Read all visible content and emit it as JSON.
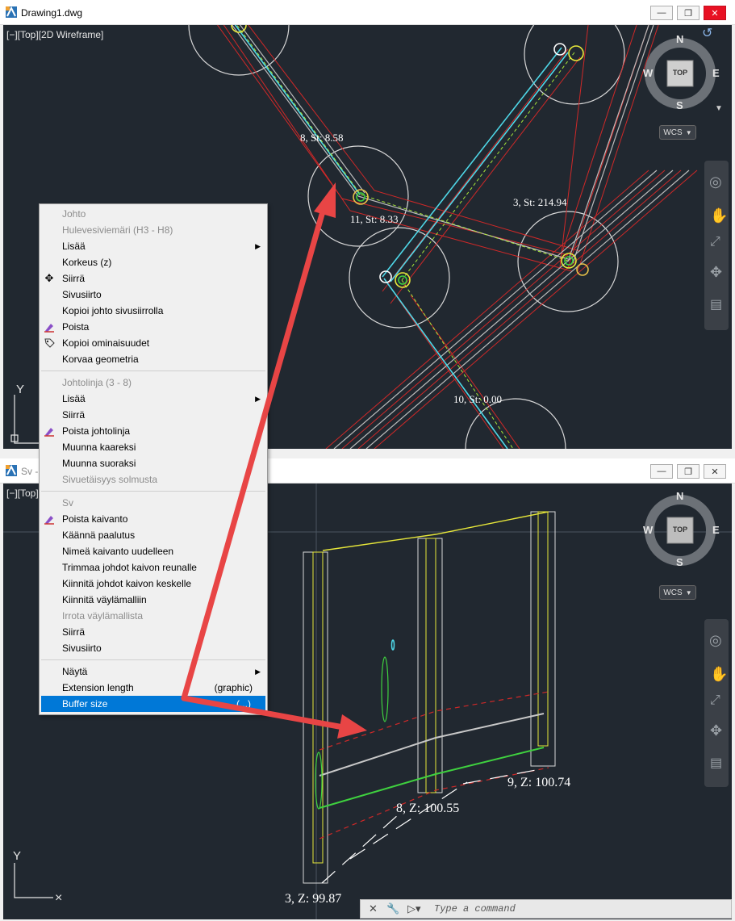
{
  "top_window": {
    "title": "Drawing1.dwg",
    "viewport_label": "[−][Top][2D Wireframe]",
    "compass": {
      "n": "N",
      "s": "S",
      "e": "E",
      "w": "W",
      "center": "TOP"
    },
    "wcs": "WCS",
    "labels": [
      "8, St: 8.58",
      "11, St: 8.33",
      "3, St: 214.94",
      "10, St: 0.00"
    ],
    "ucs_y": "Y"
  },
  "bottom_window": {
    "title": "Sv - Y...",
    "viewport_label": "[−][Top]",
    "compass": {
      "n": "N",
      "s": "S",
      "e": "E",
      "w": "W",
      "center": "TOP"
    },
    "wcs": "WCS",
    "labels": [
      "9, Z: 100.74",
      "8, Z: 100.55",
      "3, Z: 99.87"
    ],
    "ucs_y": "Y"
  },
  "context_menu": {
    "sections": [
      {
        "items": [
          {
            "label": "Johto",
            "disabled": true
          },
          {
            "label": "Hulevesiviemäri (H3 - H8)",
            "disabled": true
          },
          {
            "label": "Lisää",
            "submenu": true
          },
          {
            "label": "Korkeus (z)"
          },
          {
            "label": "Siirrä",
            "icon": "move-icon"
          },
          {
            "label": "Sivusiirto"
          },
          {
            "label": "Kopioi johto sivusiirrolla"
          },
          {
            "label": "Poista",
            "icon": "erase-icon"
          },
          {
            "label": "Kopioi ominaisuudet",
            "icon": "match-properties-icon"
          },
          {
            "label": "Korvaa geometria"
          }
        ]
      },
      {
        "items": [
          {
            "label": "Johtolinja (3 - 8)",
            "disabled": true
          },
          {
            "label": "Lisää",
            "submenu": true
          },
          {
            "label": "Siirrä"
          },
          {
            "label": "Poista johtolinja",
            "icon": "erase-icon"
          },
          {
            "label": "Muunna kaareksi"
          },
          {
            "label": "Muunna suoraksi"
          },
          {
            "label": "Sivuetäisyys solmusta",
            "disabled": true
          }
        ]
      },
      {
        "items": [
          {
            "label": "Sv",
            "disabled": true
          },
          {
            "label": "Poista kaivanto",
            "icon": "erase-icon"
          },
          {
            "label": "Käännä paalutus"
          },
          {
            "label": "Nimeä kaivanto uudelleen"
          },
          {
            "label": "Trimmaa johdot kaivon reunalle"
          },
          {
            "label": "Kiinnitä johdot kaivon keskelle"
          },
          {
            "label": "Kiinnitä väylämalliin"
          },
          {
            "label": "Irrota väylämallista",
            "disabled": true
          },
          {
            "label": "Siirrä"
          },
          {
            "label": "Sivusiirto"
          }
        ]
      },
      {
        "items": [
          {
            "label": "Näytä",
            "submenu": true
          },
          {
            "label": "Extension length",
            "right": "(graphic)"
          },
          {
            "label": "Buffer size",
            "right": "(...)",
            "selected": true
          }
        ]
      }
    ]
  },
  "command_line": {
    "placeholder": "Type a command"
  },
  "colors": {
    "viewport_bg": "#212830",
    "accent_red": "#e84545",
    "cyan": "#4fd8e8",
    "green": "#3fd13f",
    "yellow": "#e8e83a",
    "menu_highlight": "#0078d7"
  }
}
